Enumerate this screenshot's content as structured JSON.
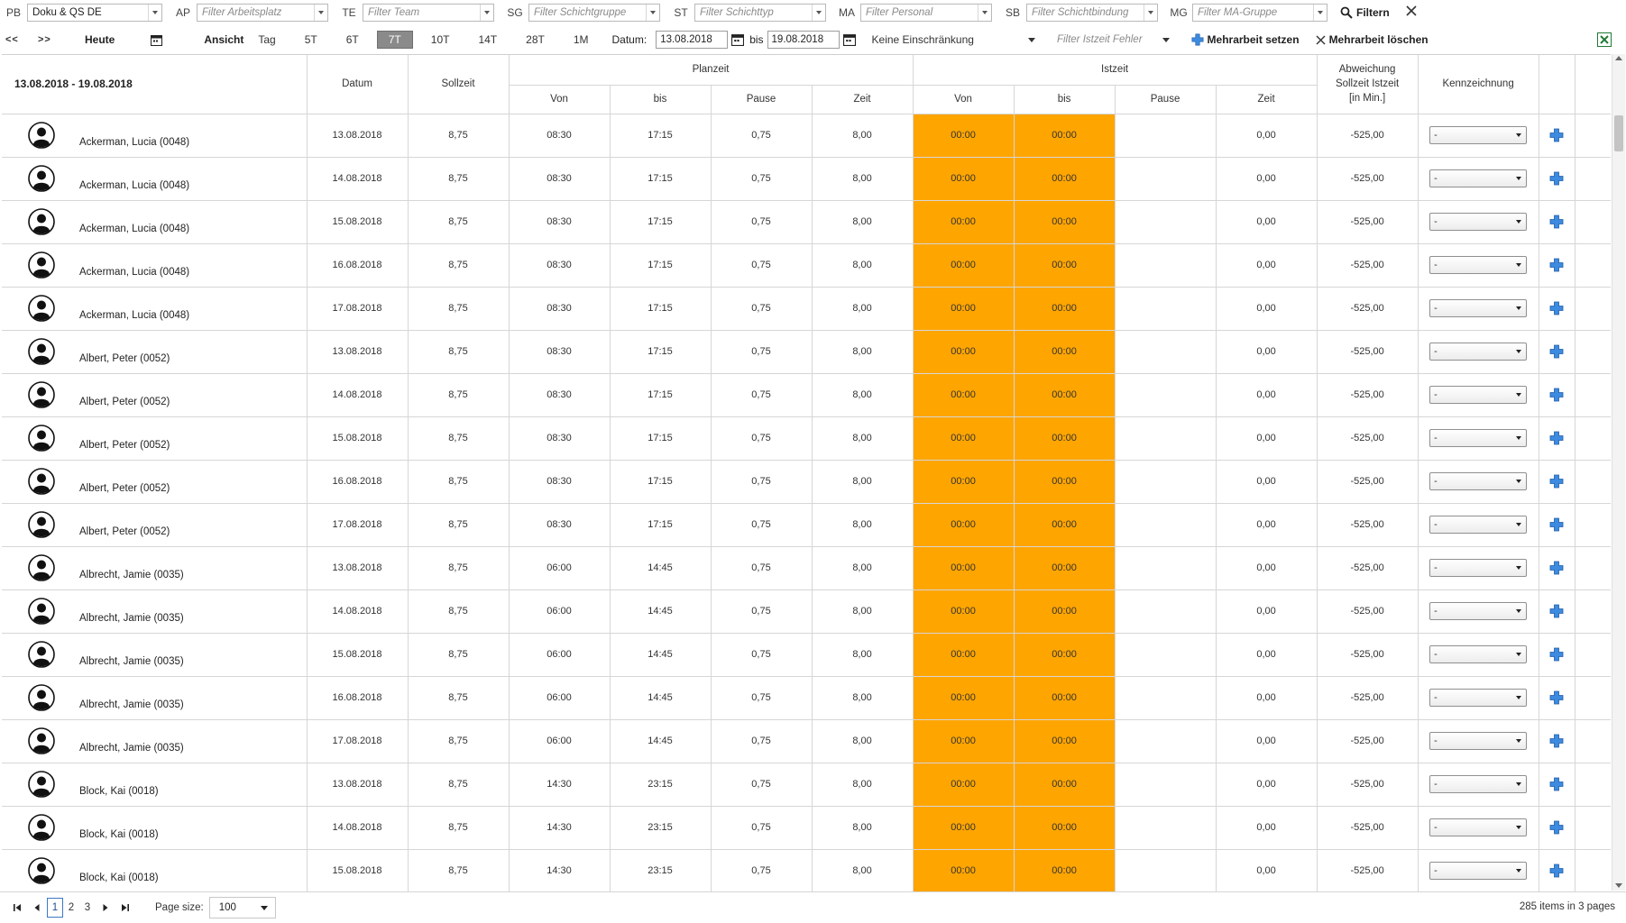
{
  "filters": [
    {
      "code": "PB",
      "placeholder": "",
      "value": "Doku & QS DE"
    },
    {
      "code": "AP",
      "placeholder": "Filter Arbeitsplatz",
      "value": ""
    },
    {
      "code": "TE",
      "placeholder": "Filter Team",
      "value": ""
    },
    {
      "code": "SG",
      "placeholder": "Filter Schichtgruppe",
      "value": ""
    },
    {
      "code": "ST",
      "placeholder": "Filter Schichttyp",
      "value": ""
    },
    {
      "code": "MA",
      "placeholder": "Filter Personal",
      "value": ""
    },
    {
      "code": "SB",
      "placeholder": "Filter Schichtbindung",
      "value": ""
    },
    {
      "code": "MG",
      "placeholder": "Filter MA-Gruppe",
      "value": ""
    }
  ],
  "filter_button": "Filtern",
  "toolbar": {
    "prev": "<<",
    "next": ">>",
    "today": "Heute",
    "view_label": "Ansicht",
    "views": [
      "Tag",
      "5T",
      "6T",
      "7T",
      "10T",
      "14T",
      "28T",
      "1M"
    ],
    "active_view": "7T",
    "date_label": "Datum:",
    "date_from": "13.08.2018",
    "bis_label": "bis",
    "date_to": "19.08.2018",
    "restriction": "Keine Einschränkung",
    "error_filter": "Filter Istzeit Fehler",
    "set_overtime": "Mehrarbeit setzen",
    "delete_overtime": "Mehrarbeit löschen"
  },
  "table": {
    "range": "13.08.2018 - 19.08.2018",
    "headers": {
      "datum": "Datum",
      "sollzeit": "Sollzeit",
      "planzeit": "Planzeit",
      "istzeit": "Istzeit",
      "von": "Von",
      "bis": "bis",
      "pause": "Pause",
      "zeit": "Zeit",
      "abweichung_1": "Abweichung",
      "abweichung_2": "Sollzeit Istzeit",
      "abweichung_3": "[in Min.]",
      "kennzeichnung": "Kennzeichnung"
    },
    "rows": [
      {
        "name": "Ackerman, Lucia (0048)",
        "datum": "13.08.2018",
        "soll": "8,75",
        "p_von": "08:30",
        "p_bis": "17:15",
        "p_pause": "0,75",
        "p_zeit": "8,00",
        "i_von": "00:00",
        "i_bis": "00:00",
        "i_pause": "",
        "i_zeit": "0,00",
        "abw": "-525,00",
        "kenn": "-"
      },
      {
        "name": "Ackerman, Lucia (0048)",
        "datum": "14.08.2018",
        "soll": "8,75",
        "p_von": "08:30",
        "p_bis": "17:15",
        "p_pause": "0,75",
        "p_zeit": "8,00",
        "i_von": "00:00",
        "i_bis": "00:00",
        "i_pause": "",
        "i_zeit": "0,00",
        "abw": "-525,00",
        "kenn": "-"
      },
      {
        "name": "Ackerman, Lucia (0048)",
        "datum": "15.08.2018",
        "soll": "8,75",
        "p_von": "08:30",
        "p_bis": "17:15",
        "p_pause": "0,75",
        "p_zeit": "8,00",
        "i_von": "00:00",
        "i_bis": "00:00",
        "i_pause": "",
        "i_zeit": "0,00",
        "abw": "-525,00",
        "kenn": "-"
      },
      {
        "name": "Ackerman, Lucia (0048)",
        "datum": "16.08.2018",
        "soll": "8,75",
        "p_von": "08:30",
        "p_bis": "17:15",
        "p_pause": "0,75",
        "p_zeit": "8,00",
        "i_von": "00:00",
        "i_bis": "00:00",
        "i_pause": "",
        "i_zeit": "0,00",
        "abw": "-525,00",
        "kenn": "-"
      },
      {
        "name": "Ackerman, Lucia (0048)",
        "datum": "17.08.2018",
        "soll": "8,75",
        "p_von": "08:30",
        "p_bis": "17:15",
        "p_pause": "0,75",
        "p_zeit": "8,00",
        "i_von": "00:00",
        "i_bis": "00:00",
        "i_pause": "",
        "i_zeit": "0,00",
        "abw": "-525,00",
        "kenn": "-"
      },
      {
        "name": "Albert, Peter (0052)",
        "datum": "13.08.2018",
        "soll": "8,75",
        "p_von": "08:30",
        "p_bis": "17:15",
        "p_pause": "0,75",
        "p_zeit": "8,00",
        "i_von": "00:00",
        "i_bis": "00:00",
        "i_pause": "",
        "i_zeit": "0,00",
        "abw": "-525,00",
        "kenn": "-"
      },
      {
        "name": "Albert, Peter (0052)",
        "datum": "14.08.2018",
        "soll": "8,75",
        "p_von": "08:30",
        "p_bis": "17:15",
        "p_pause": "0,75",
        "p_zeit": "8,00",
        "i_von": "00:00",
        "i_bis": "00:00",
        "i_pause": "",
        "i_zeit": "0,00",
        "abw": "-525,00",
        "kenn": "-"
      },
      {
        "name": "Albert, Peter (0052)",
        "datum": "15.08.2018",
        "soll": "8,75",
        "p_von": "08:30",
        "p_bis": "17:15",
        "p_pause": "0,75",
        "p_zeit": "8,00",
        "i_von": "00:00",
        "i_bis": "00:00",
        "i_pause": "",
        "i_zeit": "0,00",
        "abw": "-525,00",
        "kenn": "-"
      },
      {
        "name": "Albert, Peter (0052)",
        "datum": "16.08.2018",
        "soll": "8,75",
        "p_von": "08:30",
        "p_bis": "17:15",
        "p_pause": "0,75",
        "p_zeit": "8,00",
        "i_von": "00:00",
        "i_bis": "00:00",
        "i_pause": "",
        "i_zeit": "0,00",
        "abw": "-525,00",
        "kenn": "-"
      },
      {
        "name": "Albert, Peter (0052)",
        "datum": "17.08.2018",
        "soll": "8,75",
        "p_von": "08:30",
        "p_bis": "17:15",
        "p_pause": "0,75",
        "p_zeit": "8,00",
        "i_von": "00:00",
        "i_bis": "00:00",
        "i_pause": "",
        "i_zeit": "0,00",
        "abw": "-525,00",
        "kenn": "-"
      },
      {
        "name": "Albrecht, Jamie (0035)",
        "datum": "13.08.2018",
        "soll": "8,75",
        "p_von": "06:00",
        "p_bis": "14:45",
        "p_pause": "0,75",
        "p_zeit": "8,00",
        "i_von": "00:00",
        "i_bis": "00:00",
        "i_pause": "",
        "i_zeit": "0,00",
        "abw": "-525,00",
        "kenn": "-"
      },
      {
        "name": "Albrecht, Jamie (0035)",
        "datum": "14.08.2018",
        "soll": "8,75",
        "p_von": "06:00",
        "p_bis": "14:45",
        "p_pause": "0,75",
        "p_zeit": "8,00",
        "i_von": "00:00",
        "i_bis": "00:00",
        "i_pause": "",
        "i_zeit": "0,00",
        "abw": "-525,00",
        "kenn": "-"
      },
      {
        "name": "Albrecht, Jamie (0035)",
        "datum": "15.08.2018",
        "soll": "8,75",
        "p_von": "06:00",
        "p_bis": "14:45",
        "p_pause": "0,75",
        "p_zeit": "8,00",
        "i_von": "00:00",
        "i_bis": "00:00",
        "i_pause": "",
        "i_zeit": "0,00",
        "abw": "-525,00",
        "kenn": "-"
      },
      {
        "name": "Albrecht, Jamie (0035)",
        "datum": "16.08.2018",
        "soll": "8,75",
        "p_von": "06:00",
        "p_bis": "14:45",
        "p_pause": "0,75",
        "p_zeit": "8,00",
        "i_von": "00:00",
        "i_bis": "00:00",
        "i_pause": "",
        "i_zeit": "0,00",
        "abw": "-525,00",
        "kenn": "-"
      },
      {
        "name": "Albrecht, Jamie (0035)",
        "datum": "17.08.2018",
        "soll": "8,75",
        "p_von": "06:00",
        "p_bis": "14:45",
        "p_pause": "0,75",
        "p_zeit": "8,00",
        "i_von": "00:00",
        "i_bis": "00:00",
        "i_pause": "",
        "i_zeit": "0,00",
        "abw": "-525,00",
        "kenn": "-"
      },
      {
        "name": "Block, Kai (0018)",
        "datum": "13.08.2018",
        "soll": "8,75",
        "p_von": "14:30",
        "p_bis": "23:15",
        "p_pause": "0,75",
        "p_zeit": "8,00",
        "i_von": "00:00",
        "i_bis": "00:00",
        "i_pause": "",
        "i_zeit": "0,00",
        "abw": "-525,00",
        "kenn": "-"
      },
      {
        "name": "Block, Kai (0018)",
        "datum": "14.08.2018",
        "soll": "8,75",
        "p_von": "14:30",
        "p_bis": "23:15",
        "p_pause": "0,75",
        "p_zeit": "8,00",
        "i_von": "00:00",
        "i_bis": "00:00",
        "i_pause": "",
        "i_zeit": "0,00",
        "abw": "-525,00",
        "kenn": "-"
      },
      {
        "name": "Block, Kai (0018)",
        "datum": "15.08.2018",
        "soll": "8,75",
        "p_von": "14:30",
        "p_bis": "23:15",
        "p_pause": "0,75",
        "p_zeit": "8,00",
        "i_von": "00:00",
        "i_bis": "00:00",
        "i_pause": "",
        "i_zeit": "0,00",
        "abw": "-525,00",
        "kenn": "-"
      }
    ]
  },
  "pager": {
    "pages": [
      "1",
      "2",
      "3"
    ],
    "current": "1",
    "page_size_label": "Page size:",
    "page_size": "100",
    "info": "285 items in 3 pages"
  },
  "colors": {
    "istzeit_missing": "#ffa500",
    "accent": "#2f7ed8",
    "excel": "#1e7b34"
  }
}
